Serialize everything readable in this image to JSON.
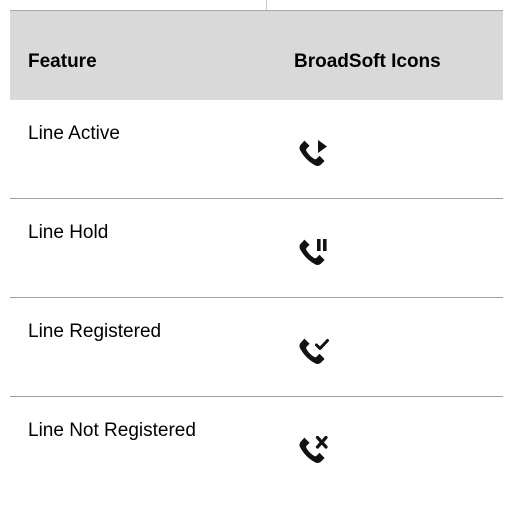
{
  "table": {
    "headers": {
      "feature": "Feature",
      "icons": "BroadSoft Icons"
    },
    "rows": [
      {
        "feature": "Line Active",
        "icon": "phone-play-icon"
      },
      {
        "feature": "Line Hold",
        "icon": "phone-pause-icon"
      },
      {
        "feature": "Line Registered",
        "icon": "phone-check-icon"
      },
      {
        "feature": "Line Not Registered",
        "icon": "phone-x-icon"
      }
    ]
  },
  "colors": {
    "header_background": "#d9d9d9",
    "rule": "#9e9e9e",
    "icon": "#111111"
  }
}
